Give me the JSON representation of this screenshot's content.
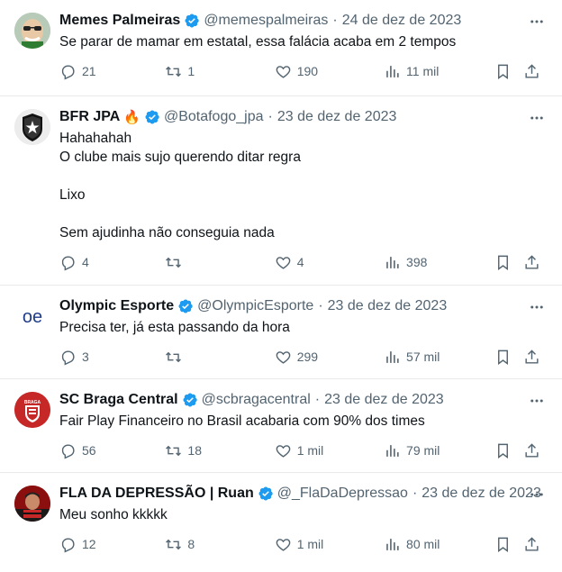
{
  "tweets": [
    {
      "name": "Memes Palmeiras",
      "handle": "@memespalmeiras",
      "date": "24 de dez de 2023",
      "lines": [
        "Se parar de mamar em estatal, essa falácia acaba em 2 tempos"
      ],
      "replies": "21",
      "retweets": "1",
      "likes": "190",
      "views": "11 mil",
      "avatar": "cartoon-face"
    },
    {
      "name": "BFR JPA",
      "emoji": "🔥",
      "handle": "@Botafogo_jpa",
      "date": "23 de dez de 2023",
      "lines": [
        "Hahahahah",
        "O clube mais sujo querendo ditar regra",
        "",
        "Lixo",
        "",
        "Sem ajudinha não conseguia nada"
      ],
      "replies": "4",
      "retweets": "",
      "likes": "4",
      "views": "398",
      "avatar": "botafogo-crest"
    },
    {
      "name": "Olympic Esporte",
      "handle": "@OlympicEsporte",
      "date": "23 de dez de 2023",
      "lines": [
        "Precisa ter, já esta passando da hora"
      ],
      "replies": "3",
      "retweets": "",
      "likes": "299",
      "views": "57 mil",
      "avatar": "oe-logo",
      "avatar_text": "oe"
    },
    {
      "name": "SC Braga Central",
      "handle": "@scbragacentral",
      "date": "23 de dez de 2023",
      "lines": [
        "Fair Play Financeiro no Brasil acabaria com 90% dos times"
      ],
      "replies": "56",
      "retweets": "18",
      "likes": "1 mil",
      "views": "79 mil",
      "avatar": "braga-crest",
      "avatar_text": "BRAGA"
    },
    {
      "name": "FLA DA DEPRESSÃO | Ruan",
      "handle": "@_FlaDaDepressao",
      "date": "23 de dez de 2023",
      "lines": [
        "Meu sonho kkkkk"
      ],
      "replies": "12",
      "retweets": "8",
      "likes": "1 mil",
      "views": "80 mil",
      "avatar": "red-portrait"
    }
  ],
  "separator": "·",
  "colors": {
    "verified": "#1d9bf0",
    "muted": "#536471",
    "text": "#0f1419",
    "border": "#e7e9ea"
  }
}
